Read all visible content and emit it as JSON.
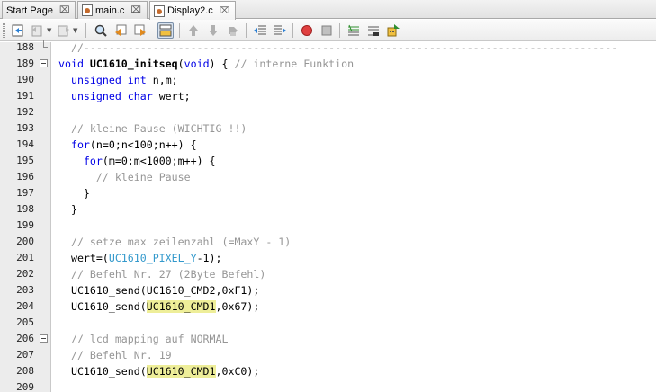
{
  "tabs": [
    {
      "label": "Start Page",
      "active": false
    },
    {
      "label": "main.c",
      "active": false
    },
    {
      "label": "Display2.c",
      "active": true
    }
  ],
  "tab_close_glyph": "⌧",
  "toolbar": {
    "icons": [
      "last-edit-icon",
      "back-icon",
      "forward-icon",
      "find-icon",
      "find-previous-icon",
      "find-next-icon",
      "toggle-highlight-icon",
      "previous-bookmark-icon",
      "next-bookmark-icon",
      "toggle-bookmark-icon",
      "shift-left-icon",
      "shift-right-icon",
      "start-macro-icon",
      "stop-macro-icon",
      "comment-icon",
      "uncomment-icon",
      "run-icon"
    ]
  },
  "colors": {
    "keyword": "#0000e6",
    "comment": "#969696",
    "macro": "#3399cc",
    "highlight": "#eeee99"
  },
  "editor": {
    "lines": [
      {
        "num": "188",
        "fold": "end",
        "segments": [
          {
            "t": "  //-------------------------------------------------------------------------------------",
            "c": "cm"
          }
        ]
      },
      {
        "num": "189",
        "fold": "open",
        "segments": [
          {
            "t": "void",
            "c": "kw"
          },
          {
            "t": " "
          },
          {
            "t": "UC1610_initseq",
            "c": "b"
          },
          {
            "t": "("
          },
          {
            "t": "void",
            "c": "kw"
          },
          {
            "t": ") { "
          },
          {
            "t": "// interne Funktion",
            "c": "cm"
          }
        ]
      },
      {
        "num": "190",
        "fold": "",
        "segments": [
          {
            "t": "  "
          },
          {
            "t": "unsigned",
            "c": "kw"
          },
          {
            "t": " "
          },
          {
            "t": "int",
            "c": "kw"
          },
          {
            "t": " n,m;"
          }
        ]
      },
      {
        "num": "191",
        "fold": "",
        "segments": [
          {
            "t": "  "
          },
          {
            "t": "unsigned",
            "c": "kw"
          },
          {
            "t": " "
          },
          {
            "t": "char",
            "c": "kw"
          },
          {
            "t": " wert;"
          }
        ]
      },
      {
        "num": "192",
        "fold": "",
        "segments": []
      },
      {
        "num": "193",
        "fold": "",
        "segments": [
          {
            "t": "  "
          },
          {
            "t": "// kleine Pause (WICHTIG !!)",
            "c": "cm"
          }
        ]
      },
      {
        "num": "194",
        "fold": "",
        "segments": [
          {
            "t": "  "
          },
          {
            "t": "for",
            "c": "kw"
          },
          {
            "t": "(n=0;n<100;n++) {"
          }
        ]
      },
      {
        "num": "195",
        "fold": "",
        "segments": [
          {
            "t": "    "
          },
          {
            "t": "for",
            "c": "kw"
          },
          {
            "t": "(m=0;m<1000;m++) {"
          }
        ]
      },
      {
        "num": "196",
        "fold": "",
        "segments": [
          {
            "t": "      "
          },
          {
            "t": "// kleine Pause",
            "c": "cm"
          }
        ]
      },
      {
        "num": "197",
        "fold": "",
        "segments": [
          {
            "t": "    }"
          }
        ]
      },
      {
        "num": "198",
        "fold": "",
        "segments": [
          {
            "t": "  }"
          }
        ]
      },
      {
        "num": "199",
        "fold": "",
        "segments": []
      },
      {
        "num": "200",
        "fold": "",
        "segments": [
          {
            "t": "  "
          },
          {
            "t": "// setze max zeilenzahl (=MaxY - 1)",
            "c": "cm"
          }
        ]
      },
      {
        "num": "201",
        "fold": "",
        "segments": [
          {
            "t": "  wert=("
          },
          {
            "t": "UC1610_PIXEL_Y",
            "c": "mc"
          },
          {
            "t": "-1);"
          }
        ]
      },
      {
        "num": "202",
        "fold": "",
        "segments": [
          {
            "t": "  "
          },
          {
            "t": "// Befehl Nr. 27 (2Byte Befehl)",
            "c": "cm"
          }
        ]
      },
      {
        "num": "203",
        "fold": "",
        "segments": [
          {
            "t": "  UC1610_send(UC1610_CMD2,0xF1);"
          }
        ]
      },
      {
        "num": "204",
        "fold": "",
        "segments": [
          {
            "t": "  UC1610_send("
          },
          {
            "t": "UC1610_CMD1",
            "c": "hl"
          },
          {
            "t": ",0x67);"
          }
        ]
      },
      {
        "num": "205",
        "fold": "",
        "segments": []
      },
      {
        "num": "206",
        "fold": "open",
        "segments": [
          {
            "t": "  "
          },
          {
            "t": "// lcd mapping auf NORMAL",
            "c": "cm"
          }
        ]
      },
      {
        "num": "207",
        "fold": "",
        "segments": [
          {
            "t": "  "
          },
          {
            "t": "// Befehl Nr. 19",
            "c": "cm"
          }
        ]
      },
      {
        "num": "208",
        "fold": "",
        "segments": [
          {
            "t": "  UC1610_send("
          },
          {
            "t": "UC1610_CMD1",
            "c": "hl"
          },
          {
            "t": ",0xC0);"
          }
        ]
      },
      {
        "num": "209",
        "fold": "",
        "segments": []
      }
    ]
  }
}
